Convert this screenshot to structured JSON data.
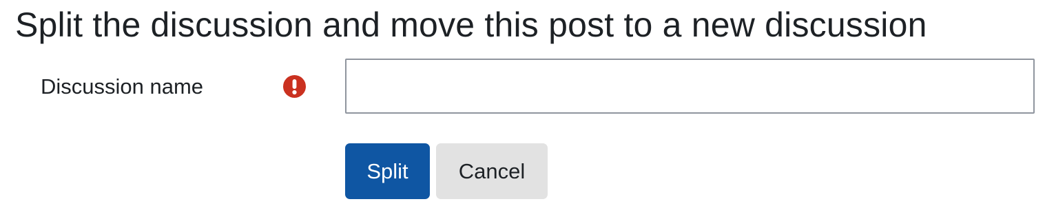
{
  "page": {
    "title": "Split the discussion and move this post to a new discussion"
  },
  "form": {
    "discussion_name": {
      "label": "Discussion name",
      "value": "",
      "required": true,
      "required_icon": "exclamation-circle-icon",
      "required_icon_color": "#ca3120"
    },
    "buttons": {
      "split_label": "Split",
      "cancel_label": "Cancel"
    }
  },
  "colors": {
    "primary": "#0f56a3",
    "secondary": "#e2e2e2",
    "text": "#1d2125",
    "danger": "#ca3120"
  }
}
